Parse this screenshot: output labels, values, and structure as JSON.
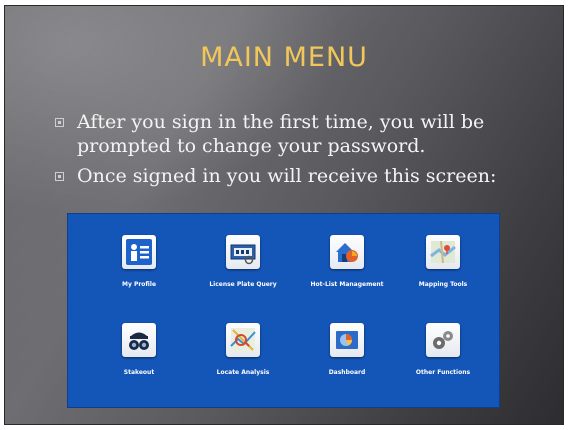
{
  "slide": {
    "title": "MAIN MENU",
    "bullets": [
      "After you sign in the first time, you will be prompted to change your password.",
      "Once signed in you will receive this screen:"
    ],
    "title_color": "#f2c75a"
  },
  "app_screen": {
    "background_color": "#1455b8",
    "tiles": [
      {
        "label": "My Profile",
        "icon": "profile-icon"
      },
      {
        "label": "License Plate Query",
        "icon": "license-plate-icon"
      },
      {
        "label": "Hot-List Management",
        "icon": "hot-list-icon"
      },
      {
        "label": "Mapping Tools",
        "icon": "map-icon"
      },
      {
        "label": "Stakeout",
        "icon": "stakeout-icon"
      },
      {
        "label": "Locate Analysis",
        "icon": "locate-analysis-icon"
      },
      {
        "label": "Dashboard",
        "icon": "dashboard-icon"
      },
      {
        "label": "Other Functions",
        "icon": "gears-icon"
      }
    ]
  }
}
